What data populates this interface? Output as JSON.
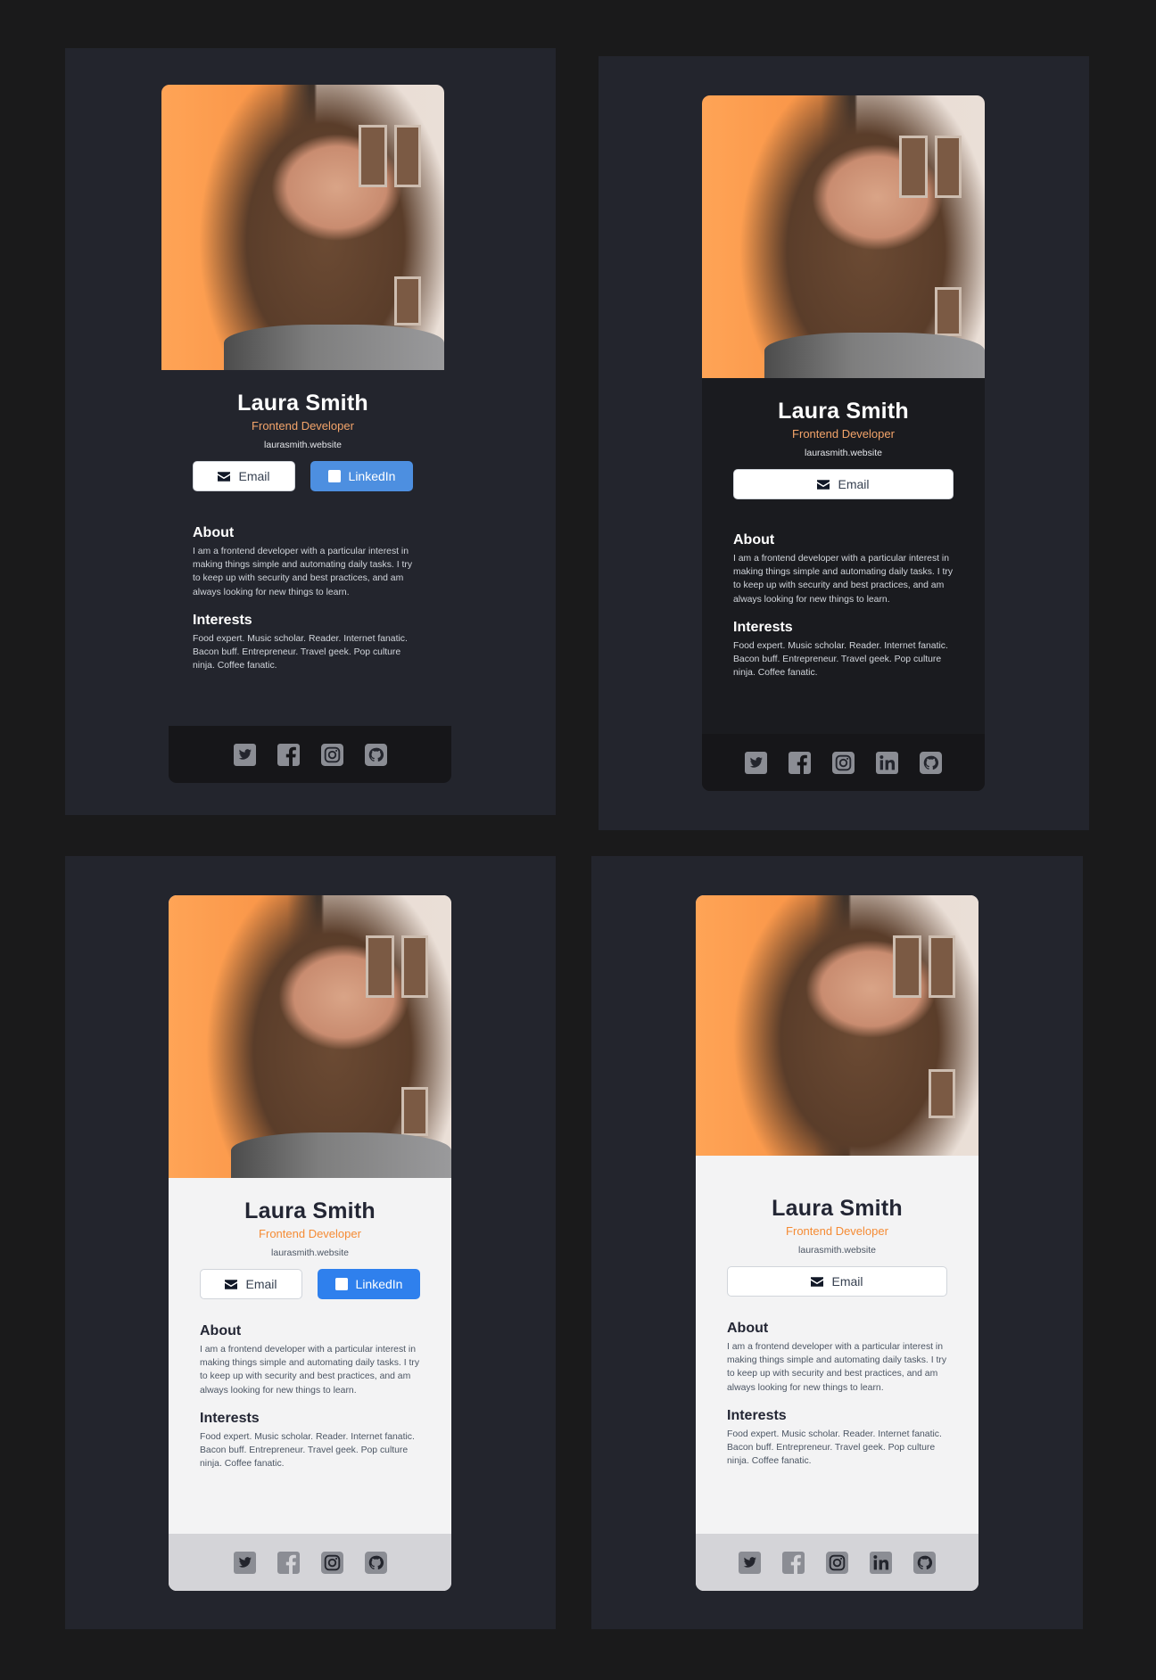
{
  "profile": {
    "name": "Laura Smith",
    "title": "Frontend Developer",
    "website": "laurasmith.website",
    "email_label": "Email",
    "linkedin_label": "LinkedIn",
    "about_heading": "About",
    "about_text": "I am a frontend developer with a particular interest in making things simple and automating daily tasks. I try to keep up with security and best practices, and am always looking for new things to learn.",
    "interests_heading": "Interests",
    "interests_text": "Food expert. Music scholar. Reader. Internet fanatic. Bacon buff. Entrepreneur. Travel geek. Pop culture ninja. Coffee fanatic."
  },
  "social_icons": [
    "twitter-icon",
    "facebook-icon",
    "instagram-icon",
    "linkedin-icon",
    "github-icon"
  ],
  "colors": {
    "background": "#1a1a1b",
    "panel": "#23252d",
    "accent_orange": "#f58b34",
    "linkedin_blue": "#2f80ed",
    "dark_card": "#1a1b1f",
    "light_card": "#f3f3f4"
  }
}
